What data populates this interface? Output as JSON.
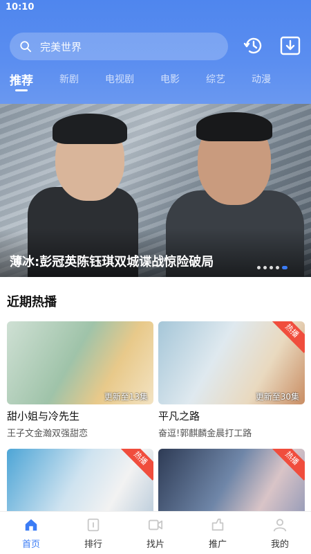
{
  "status_bar": {
    "time": "10:10"
  },
  "search": {
    "placeholder": "完美世界"
  },
  "tabs": [
    {
      "label": "推荐",
      "active": true
    },
    {
      "label": "新剧"
    },
    {
      "label": "电视剧"
    },
    {
      "label": "电影"
    },
    {
      "label": "综艺"
    },
    {
      "label": "动漫"
    }
  ],
  "banner": {
    "title": "薄冰:彭冠英陈钰琪双城谍战惊险破局",
    "page_count": 5,
    "active_index": 4
  },
  "section": {
    "title": "近期热播"
  },
  "cards": [
    {
      "title": "甜小姐与冷先生",
      "subtitle": "王子文金瀚双强甜恋",
      "badge": "更新至13集",
      "corner": ""
    },
    {
      "title": "平凡之路",
      "subtitle": "奋逗!郭麒麟金晨打工路",
      "badge": "更新至30集",
      "corner": "热播"
    },
    {
      "title": "",
      "subtitle": "",
      "badge": "",
      "corner": "热播"
    },
    {
      "title": "",
      "subtitle": "",
      "badge": "",
      "corner": "热播"
    }
  ],
  "bottom_nav": [
    {
      "label": "首页",
      "icon": "home-icon",
      "active": true
    },
    {
      "label": "排行",
      "icon": "ranking-icon"
    },
    {
      "label": "找片",
      "icon": "video-icon"
    },
    {
      "label": "推广",
      "icon": "share-icon"
    },
    {
      "label": "我的",
      "icon": "profile-icon"
    }
  ],
  "colors": {
    "header": "#5b8ef0",
    "accent": "#3b7cf5",
    "corner": "#f04d3d"
  }
}
